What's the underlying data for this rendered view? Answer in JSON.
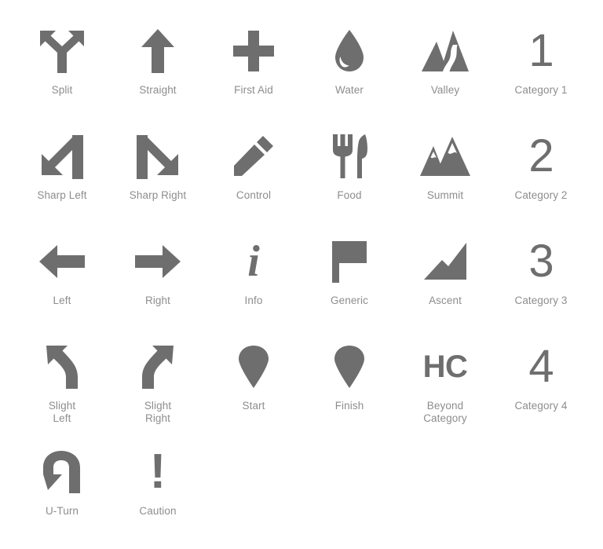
{
  "page": {
    "background": "#ffffff",
    "icon_color": "#6e6e6e",
    "label_color": "#8d8d8d",
    "columns": 6,
    "rows": 5
  },
  "icons": [
    {
      "name": "split",
      "label": "Split",
      "glyph": "split-icon"
    },
    {
      "name": "straight",
      "label": "Straight",
      "glyph": "straight-arrow-icon"
    },
    {
      "name": "first-aid",
      "label": "First Aid",
      "glyph": "cross-icon"
    },
    {
      "name": "water",
      "label": "Water",
      "glyph": "water-droplet-icon"
    },
    {
      "name": "valley",
      "label": "Valley",
      "glyph": "valley-mountains-icon"
    },
    {
      "name": "category-1",
      "label": "Category 1",
      "glyph": "number-1-glyph",
      "text": "1"
    },
    {
      "name": "sharp-left",
      "label": "Sharp Left",
      "glyph": "sharp-left-arrow-icon"
    },
    {
      "name": "sharp-right",
      "label": "Sharp Right",
      "glyph": "sharp-right-arrow-icon"
    },
    {
      "name": "control",
      "label": "Control",
      "glyph": "pencil-icon"
    },
    {
      "name": "food",
      "label": "Food",
      "glyph": "fork-knife-icon"
    },
    {
      "name": "summit",
      "label": "Summit",
      "glyph": "summit-mountains-icon"
    },
    {
      "name": "category-2",
      "label": "Category 2",
      "glyph": "number-2-glyph",
      "text": "2"
    },
    {
      "name": "left",
      "label": "Left",
      "glyph": "left-arrow-icon"
    },
    {
      "name": "right",
      "label": "Right",
      "glyph": "right-arrow-icon"
    },
    {
      "name": "info",
      "label": "Info",
      "glyph": "info-i-glyph",
      "text": "i"
    },
    {
      "name": "generic",
      "label": "Generic",
      "glyph": "flag-icon"
    },
    {
      "name": "ascent",
      "label": "Ascent",
      "glyph": "ascent-chart-icon"
    },
    {
      "name": "category-3",
      "label": "Category 3",
      "glyph": "number-3-glyph",
      "text": "3"
    },
    {
      "name": "slight-left",
      "label": "Slight\nLeft",
      "glyph": "slight-left-arrow-icon"
    },
    {
      "name": "slight-right",
      "label": "Slight\nRight",
      "glyph": "slight-right-arrow-icon"
    },
    {
      "name": "start",
      "label": "Start",
      "glyph": "map-pin-icon"
    },
    {
      "name": "finish",
      "label": "Finish",
      "glyph": "map-pin-icon"
    },
    {
      "name": "beyond-category",
      "label": "Beyond\nCategory",
      "glyph": "hc-glyph",
      "text": "HC"
    },
    {
      "name": "category-4",
      "label": "Category 4",
      "glyph": "number-4-glyph",
      "text": "4"
    },
    {
      "name": "u-turn",
      "label": "U-Turn",
      "glyph": "u-turn-arrow-icon"
    },
    {
      "name": "caution",
      "label": "Caution",
      "glyph": "exclamation-glyph",
      "text": "!"
    }
  ]
}
